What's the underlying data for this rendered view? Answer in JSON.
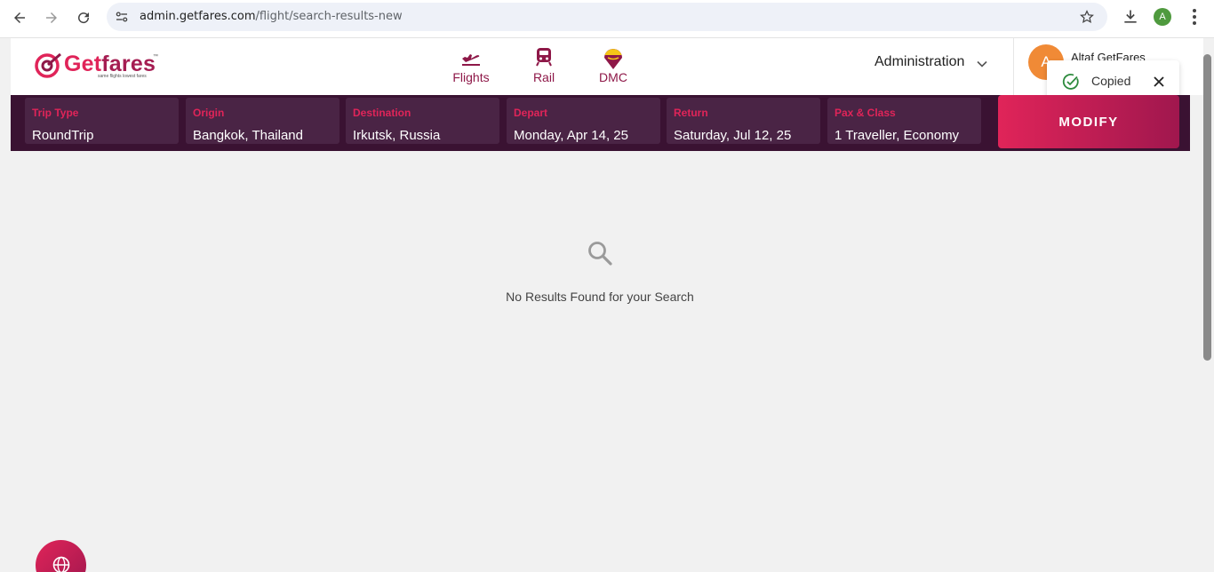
{
  "browser": {
    "url_host": "admin.getfares.com",
    "url_path": "/flight/search-results-new",
    "profile_initial": "A"
  },
  "header": {
    "logo": {
      "brand_first": "Get",
      "brand_rest": "fares",
      "tm": "™",
      "tagline": "same flights lowest fares"
    },
    "nav": [
      {
        "label": "Flights",
        "icon": "airplane-takeoff-icon"
      },
      {
        "label": "Rail",
        "icon": "train-icon"
      },
      {
        "label": "DMC",
        "icon": "dmc-location-icon"
      }
    ],
    "admin_label": "Administration",
    "user_initial": "A",
    "user_name": "Altaf GetFares"
  },
  "toast": {
    "message": "Copied"
  },
  "search": {
    "fields": [
      {
        "label": "Trip Type",
        "value": "RoundTrip"
      },
      {
        "label": "Origin",
        "value": "Bangkok, Thailand"
      },
      {
        "label": "Destination",
        "value": "Irkutsk, Russia"
      },
      {
        "label": "Depart",
        "value": "Monday, Apr 14, 25"
      },
      {
        "label": "Return",
        "value": "Saturday, Jul 12, 25"
      },
      {
        "label": "Pax & Class",
        "value": "1 Traveller, Economy"
      }
    ],
    "modify_label": "MODIFY"
  },
  "results": {
    "empty_message": "No Results Found for your Search"
  },
  "colors": {
    "brand_pink": "#e02459",
    "brand_plum": "#8e1848",
    "strip_bg": "#3a1232",
    "field_bg": "#4a2445"
  }
}
